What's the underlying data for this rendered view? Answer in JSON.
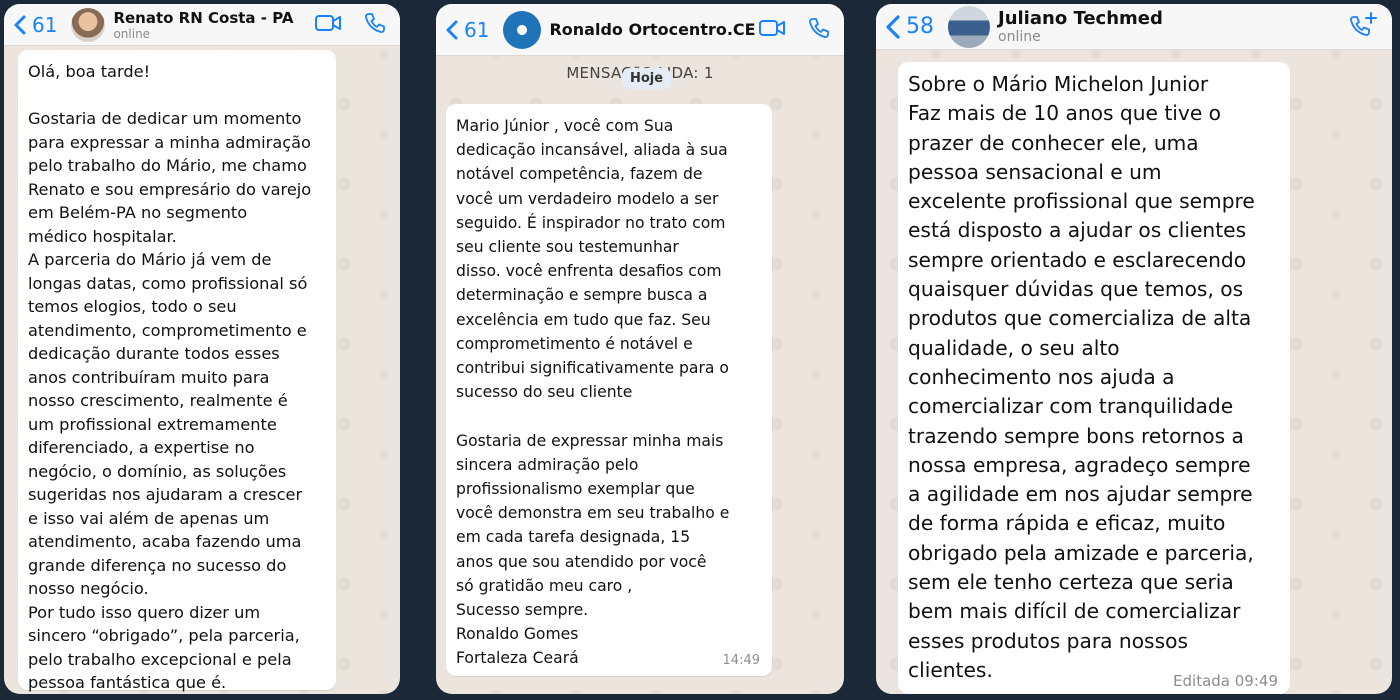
{
  "chats": [
    {
      "back_count": "61",
      "contact_name": "Renato RN Costa - PA",
      "status": "online",
      "message": "Olá, boa tarde!\n\nGostaria de dedicar um momento\npara expressar a minha admiração\npelo trabalho do Mário, me chamo\nRenato e sou empresário do varejo\nem Belém-PA no segmento\nmédico hospitalar.\nA parceria do Mário já vem de\nlongas datas, como profissional só\ntemos elogios, todo o seu\natendimento, comprometimento e\ndedicação durante todos esses\nanos contribuíram muito para\nnosso crescimento, realmente é\num profissional extremamente\ndiferenciado, a expertise no\nnegócio, o domínio, as soluções\nsugeridas nos ajudaram a crescer\ne isso vai além de apenas um\natendimento, acaba fazendo uma\ngrande diferença no sucesso do\nnosso negócio.\nPor tudo isso quero dizer um\nsincero “obrigado”, pela parceria,\npelo trabalho excepcional e pela\npessoa fantástica que é."
    },
    {
      "back_count": "61",
      "contact_name": "Ronaldo Ortocentro.CE",
      "unread_banner": "MENSAG˜O LIDA: 1",
      "day_chip": "Hoje",
      "message": "Mario Júnior , você com Sua\ndedicação incansável, aliada à sua\nnotável competência, fazem de\nvocê um verdadeiro modelo a ser\nseguido. É inspirador no trato com\nseu cliente sou testemunhar\ndisso. você enfrenta desafios com\ndeterminação e sempre busca a\nexcelência em tudo que faz. Seu\ncomprometimento é notável e\ncontribui significativamente para o\nsucesso do seu cliente\n\nGostaria de expressar minha mais\nsincera admiração pelo\nprofissionalismo exemplar que\nvocê demonstra em seu trabalho e\nem cada tarefa designada, 15\nanos que  sou atendido por você\nsó gratidão meu caro ,\nSucesso sempre.\nRonaldo Gomes\nFortaleza Ceará",
      "time": "14:49"
    },
    {
      "back_count": "58",
      "contact_name": "Juliano Techmed",
      "status": "online",
      "message": "Sobre o Mário Michelon Junior\nFaz mais de 10 anos que tive o\nprazer de conhecer ele, uma\npessoa sensacional e um\nexcelente profissional que sempre\nestá disposto a ajudar os clientes\nsempre orientado e esclarecendo\nquaisquer dúvidas que temos, os\nprodutos que comercializa de alta\nqualidade, o seu alto\nconhecimento nos ajuda a\ncomercializar com tranquilidade\ntrazendo sempre bons retornos a\nnossa empresa, agradeço sempre\na agilidade em nos ajudar sempre\nde forma rápida e eficaz, muito\nobrigado pela amizade e parceria,\nsem ele tenho certeza que seria\nbem mais difícil de comercializar\nesses produtos para nossos\nclientes.",
      "time": "Editada 09:49"
    }
  ],
  "colors": {
    "accent": "#1a82fb",
    "background": "#1a2838",
    "chat_bg": "#ece5dd",
    "bubble": "#ffffff"
  },
  "icons": {
    "back": "chevron-left-icon",
    "video": "video-camera-icon",
    "call": "phone-icon",
    "add_call": "phone-plus-icon"
  }
}
